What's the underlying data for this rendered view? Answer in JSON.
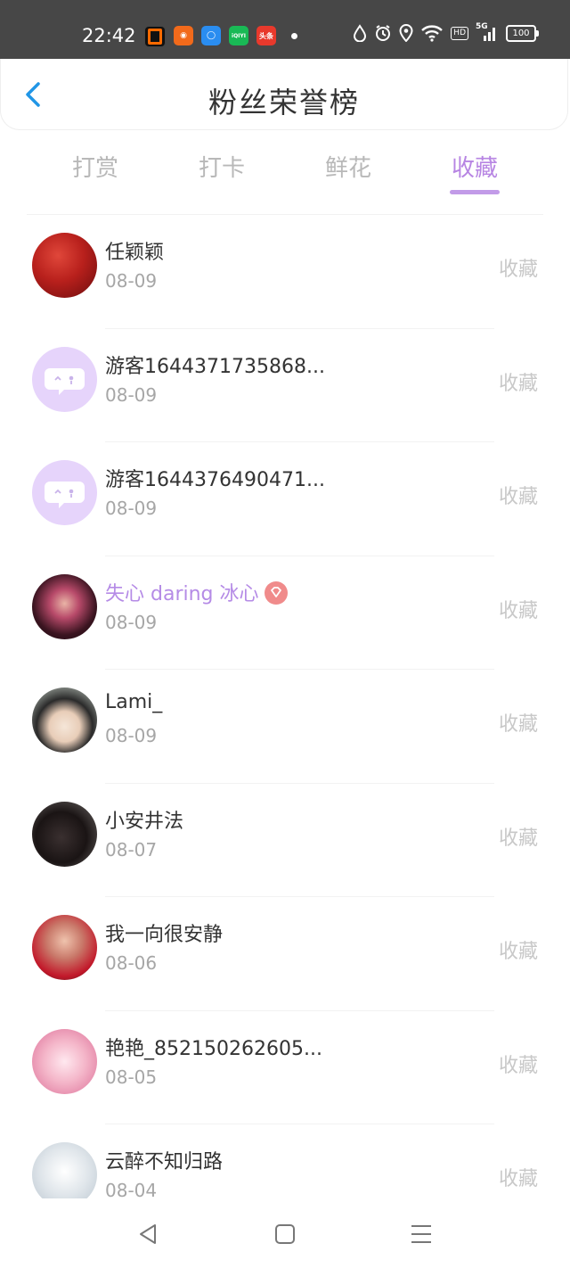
{
  "status_bar": {
    "time": "22:42",
    "battery": "100",
    "hd_badge": "HD",
    "network": "5G",
    "app_icons": [
      {
        "name": "app-icon-1",
        "color": "#e8391f",
        "label": "Q"
      },
      {
        "name": "app-icon-2",
        "color": "#f26a1b",
        "label": "◉"
      },
      {
        "name": "app-icon-3",
        "color": "#2a8df0",
        "label": "◯"
      },
      {
        "name": "app-icon-4",
        "color": "#19b955",
        "label": "iQIYI"
      },
      {
        "name": "app-icon-5",
        "color": "#e8392c",
        "label": "头条"
      }
    ]
  },
  "header": {
    "title": "粉丝荣誉榜",
    "back_icon": "chevron-left-icon"
  },
  "tabs": [
    {
      "label": "打赏",
      "active": false
    },
    {
      "label": "打卡",
      "active": false
    },
    {
      "label": "鲜花",
      "active": false
    },
    {
      "label": "收藏",
      "active": true
    }
  ],
  "list": [
    {
      "name": "任颖颖",
      "date": "08-09",
      "action": "收藏",
      "vip": false,
      "avatar": "avatar-red"
    },
    {
      "name": "游客1644371735868...",
      "date": "08-09",
      "action": "收藏",
      "vip": false,
      "avatar": "guest"
    },
    {
      "name": "游客1644376490471...",
      "date": "08-09",
      "action": "收藏",
      "vip": false,
      "avatar": "guest"
    },
    {
      "name": "失心 daring 冰心",
      "date": "08-09",
      "action": "收藏",
      "vip": true,
      "avatar": "avatar-fairy"
    },
    {
      "name": "Lami_",
      "date": "08-09",
      "action": "收藏",
      "vip": false,
      "avatar": "avatar-anime"
    },
    {
      "name": "小安井法",
      "date": "08-07",
      "action": "收藏",
      "vip": false,
      "avatar": "avatar-dark"
    },
    {
      "name": "我一向很安静",
      "date": "08-06",
      "action": "收藏",
      "vip": false,
      "avatar": "avatar-couple"
    },
    {
      "name": "艳艳_852150262605...",
      "date": "08-05",
      "action": "收藏",
      "vip": false,
      "avatar": "avatar-pink"
    },
    {
      "name": "云醉不知归路",
      "date": "08-04",
      "action": "收藏",
      "vip": false,
      "avatar": "avatar-light"
    }
  ],
  "nav_bar": {
    "back": "back-triangle-icon",
    "home": "home-square-icon",
    "menu": "menu-lines-icon"
  }
}
